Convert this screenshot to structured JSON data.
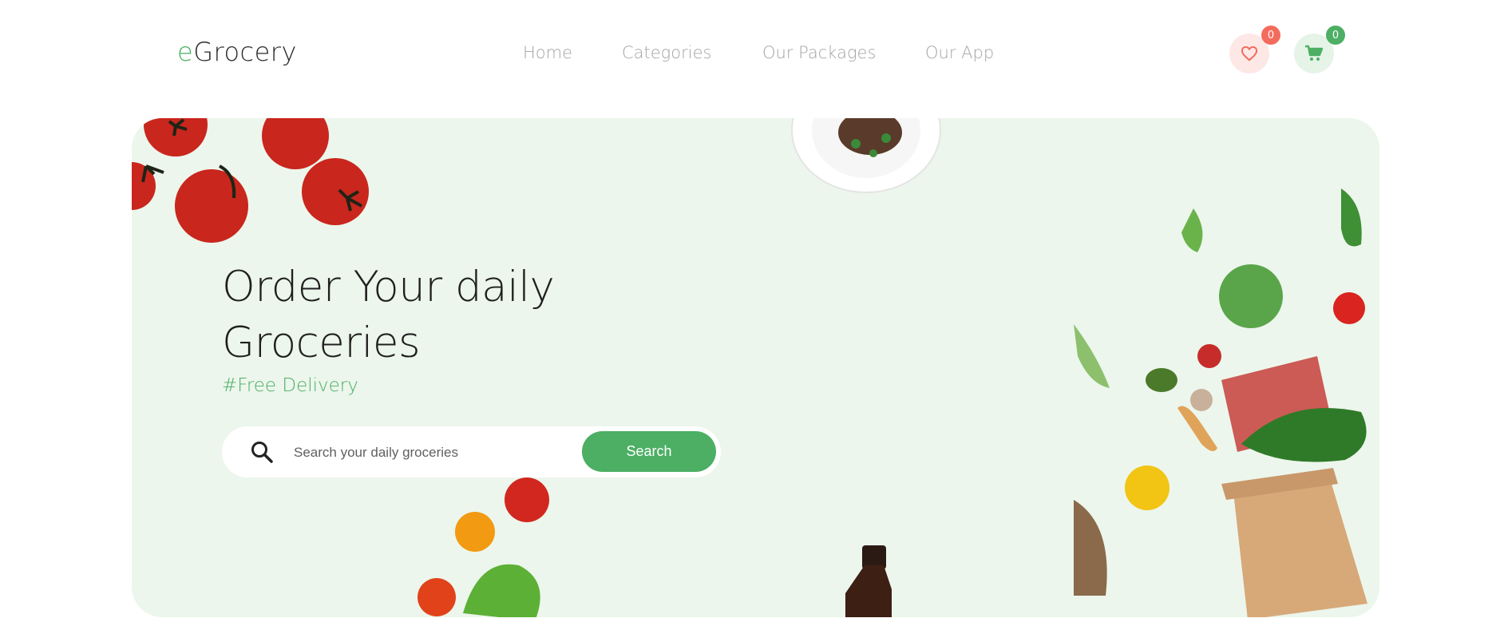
{
  "brand": {
    "prefix": "e",
    "name": "Grocery"
  },
  "nav": {
    "items": [
      {
        "label": "Home"
      },
      {
        "label": "Categories"
      },
      {
        "label": "Our Packages"
      },
      {
        "label": "Our App"
      }
    ]
  },
  "actions": {
    "wishlist": {
      "count": "0",
      "icon": "heart-icon",
      "color": "#f36b5d",
      "bg": "#fde8e6"
    },
    "cart": {
      "count": "0",
      "icon": "cart-icon",
      "color": "#4caf64",
      "bg": "#e6f4e8"
    }
  },
  "hero": {
    "headline_line1": "Order Your daily",
    "headline_line2": "Groceries",
    "subline": "#Free Delivery",
    "search": {
      "placeholder": "Search your daily groceries",
      "value": "",
      "button_label": "Search"
    }
  },
  "colors": {
    "accent": "#4caf64",
    "hero_bg": "#ecf6ec",
    "badge_red": "#f36b5d"
  }
}
